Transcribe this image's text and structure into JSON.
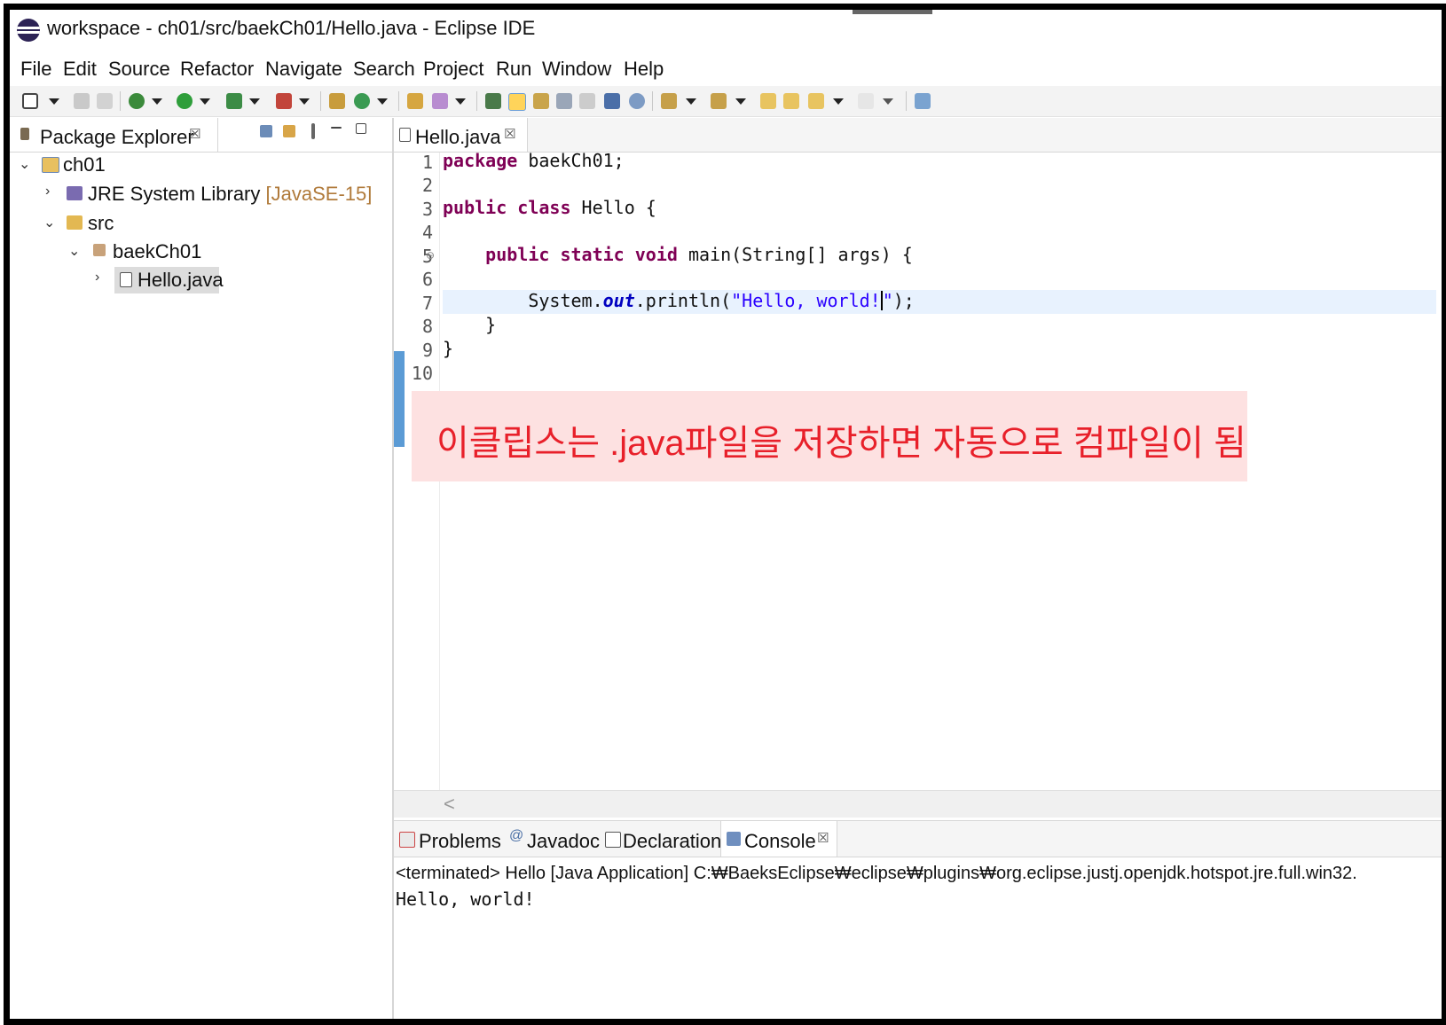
{
  "window": {
    "title": "workspace - ch01/src/baekCh01/Hello.java - Eclipse IDE"
  },
  "menu": [
    "File",
    "Edit",
    "Source",
    "Refactor",
    "Navigate",
    "Search",
    "Project",
    "Run",
    "Window",
    "Help"
  ],
  "package_explorer": {
    "tab_label": "Package Explorer",
    "close_glyph": "☒",
    "tree": {
      "project": "ch01",
      "jre": "JRE System Library",
      "jre_version": "[JavaSE-15]",
      "src": "src",
      "package": "baekCh01",
      "file": "Hello.java"
    }
  },
  "editor": {
    "tab_label": "Hello.java",
    "close_glyph": "☒",
    "line_numbers": [
      "1",
      "2",
      "3",
      "4",
      "5",
      "6",
      "7",
      "8",
      "9",
      "10"
    ],
    "code": {
      "l1_kw": "package",
      "l1_rest": " baekCh01;",
      "l3_kw1": "public",
      "l3_kw2": "class",
      "l3_rest": " Hello {",
      "l5_kw1": "public",
      "l5_kw2": "static",
      "l5_kw3": "void",
      "l5_rest": " main(String[] args) {",
      "l7_pre": "System.",
      "l7_field": "out",
      "l7_mid": ".println(",
      "l7_str1": "\"Hello, world!",
      "l7_str2": "\"",
      "l7_end": ");",
      "l8": "}",
      "l9": "}"
    },
    "scroll_left_glyph": "<"
  },
  "callout": {
    "text": "이클립스는 .java파일을 저장하면 자동으로 컴파일이 됨"
  },
  "bottom_panel": {
    "tabs": {
      "problems": "Problems",
      "javadoc_prefix": "@",
      "javadoc": "Javadoc",
      "declaration": "Declaration",
      "console": "Console",
      "close_glyph": "☒"
    },
    "console_header": "<terminated> Hello [Java Application] C:₩BaeksEclipse₩eclipse₩plugins₩org.eclipse.justj.openjdk.hotspot.jre.full.win32.",
    "console_output": "Hello, world!"
  },
  "colors": {
    "keyword": "#7f0055",
    "string": "#2a00ff",
    "callout_text": "#e8202a",
    "callout_bg": "#fde1e1"
  }
}
